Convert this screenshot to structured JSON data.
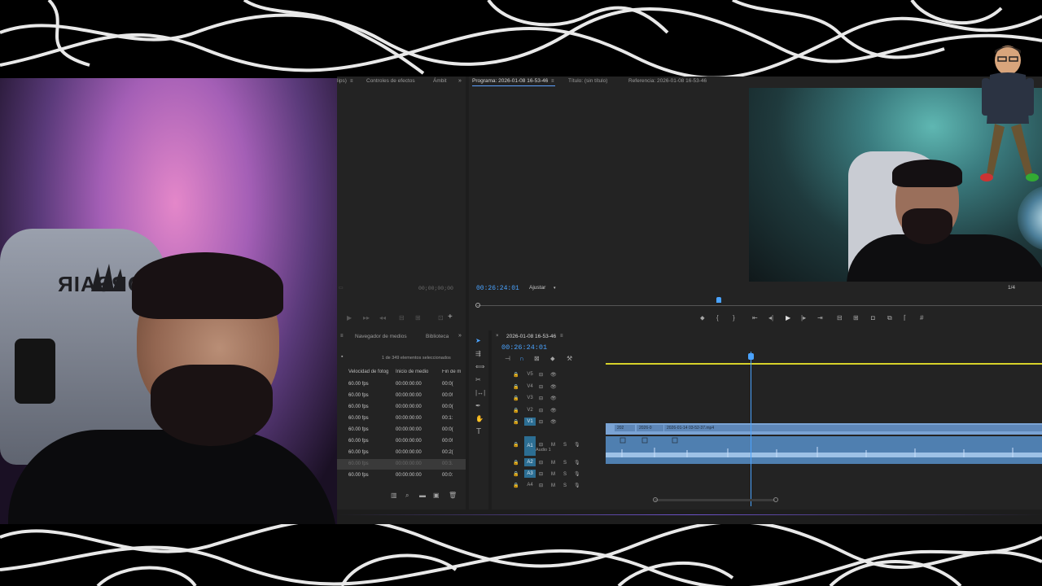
{
  "source_monitor": {
    "tabs": [
      "lips)",
      "Controles de efectos",
      "Ámbit"
    ],
    "timecode": "00;00;00;00"
  },
  "program_monitor": {
    "title": "Programa: 2026-01-08 16-53-46",
    "tab_title": "Título: (sin título)",
    "tab_reference": "Referencia: 2026-01-08 16-53-46",
    "timecode": "00:26:24:01",
    "zoom": "Ajustar",
    "resolution": "1/4"
  },
  "project_panel": {
    "tabs": [
      "Navegador de medios",
      "Biblioteca"
    ],
    "status": "1 de 349 elementos seleccionados",
    "columns": [
      "Velocidad de fotog",
      "Inicio de medio",
      "Fin de m"
    ],
    "rows": [
      {
        "fps": "60.00 fps",
        "start": "00:00:00:00",
        "end": "00:0("
      },
      {
        "fps": "60.00 fps",
        "start": "00:00:00:00",
        "end": "00:0!"
      },
      {
        "fps": "60.00 fps",
        "start": "00:00:00:00",
        "end": "00:0("
      },
      {
        "fps": "60.00 fps",
        "start": "00:00:00:00",
        "end": "00:1:"
      },
      {
        "fps": "60.00 fps",
        "start": "00:00:00:00",
        "end": "00:0("
      },
      {
        "fps": "60.00 fps",
        "start": "00:00:00:00",
        "end": "00:0!"
      },
      {
        "fps": "60.00 fps",
        "start": "00:00:00:00",
        "end": "00:2("
      },
      {
        "fps": "60.00 fps",
        "start": "00:00:00:00",
        "end": "00:3."
      },
      {
        "fps": "60.00 fps",
        "start": "00:00:00:00",
        "end": "00:0:"
      }
    ],
    "selected_index": 7
  },
  "timeline": {
    "sequence_name": "2026-01-08 16-53-46",
    "timecode": "00:26:24:01",
    "video_tracks": [
      "V5",
      "V4",
      "V3",
      "V2",
      "V1"
    ],
    "audio_tracks": [
      "A1",
      "A2",
      "A3",
      "A4"
    ],
    "audio_track_name": "Audio 1",
    "clips": [
      {
        "label": "202"
      },
      {
        "label": "2026-0"
      },
      {
        "label": "2026-01-14 03-52-37.mp4"
      }
    ]
  },
  "chair_logo_text": "CORSAIR",
  "colors": {
    "accent": "#4aa3ff",
    "clip": "#7aa3d4",
    "yellow_bar": "#d6d12a",
    "track_on": "#2c6e93"
  }
}
